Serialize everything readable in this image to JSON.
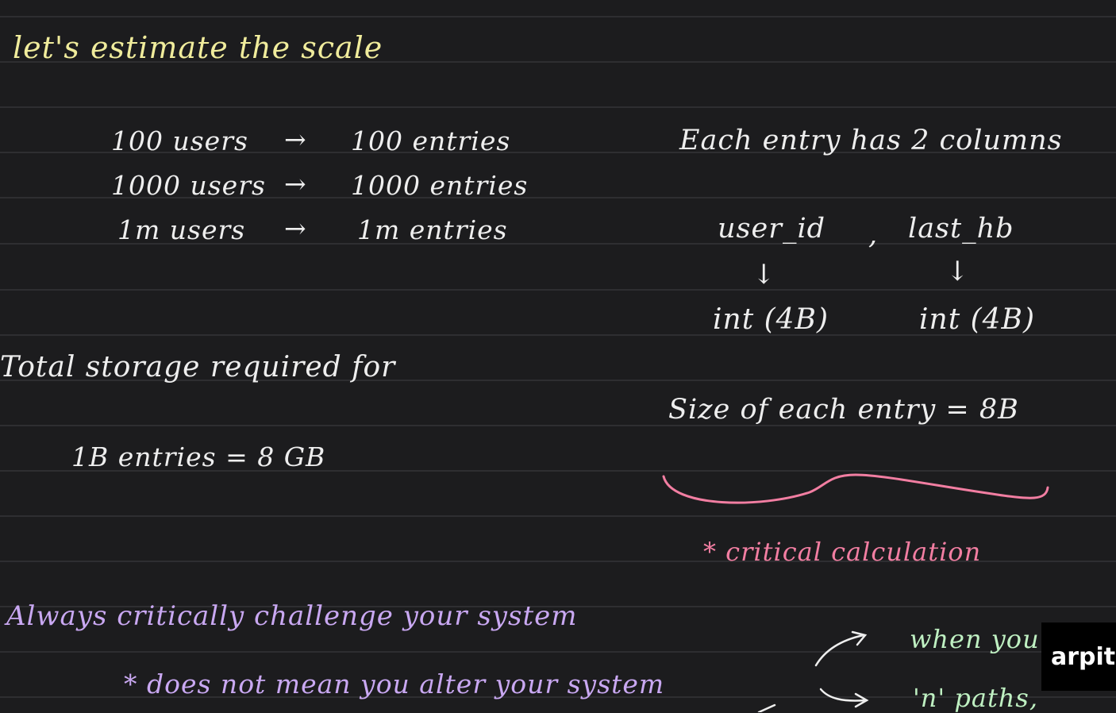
{
  "title": "let's estimate the scale",
  "scale_rows": [
    {
      "users": "100 users",
      "entries": "100 entries"
    },
    {
      "users": "1000 users",
      "entries": "1000 entries"
    },
    {
      "users": "1m users",
      "entries": "1m entries"
    }
  ],
  "arrow_glyph": "→",
  "columns_heading": "Each entry has 2 columns",
  "column_names": {
    "user_id": "user_id",
    "comma": ",",
    "last_hb": "last_hb"
  },
  "column_types": {
    "user_id": "int (4B)",
    "last_hb": "int (4B)"
  },
  "down_arrow": "↓",
  "entry_size": "Size of each entry = 8B",
  "total_storage_label": "Total storage required for",
  "total_storage_value": "1B entries = 8 GB",
  "critical_note": "* critical calculation",
  "always_text": "Always critically challenge your system",
  "note_text": "* does not mean you alter your system",
  "right_notes": {
    "line1": "when you",
    "line2": "'n' paths,"
  },
  "watermark": "arpit",
  "colors": {
    "background": "#1c1c1e",
    "yellow": "#f0ec9c",
    "white": "#eeeeee",
    "pink": "#f27ea2",
    "purple": "#c9a8f2",
    "green": "#bff0c2"
  }
}
